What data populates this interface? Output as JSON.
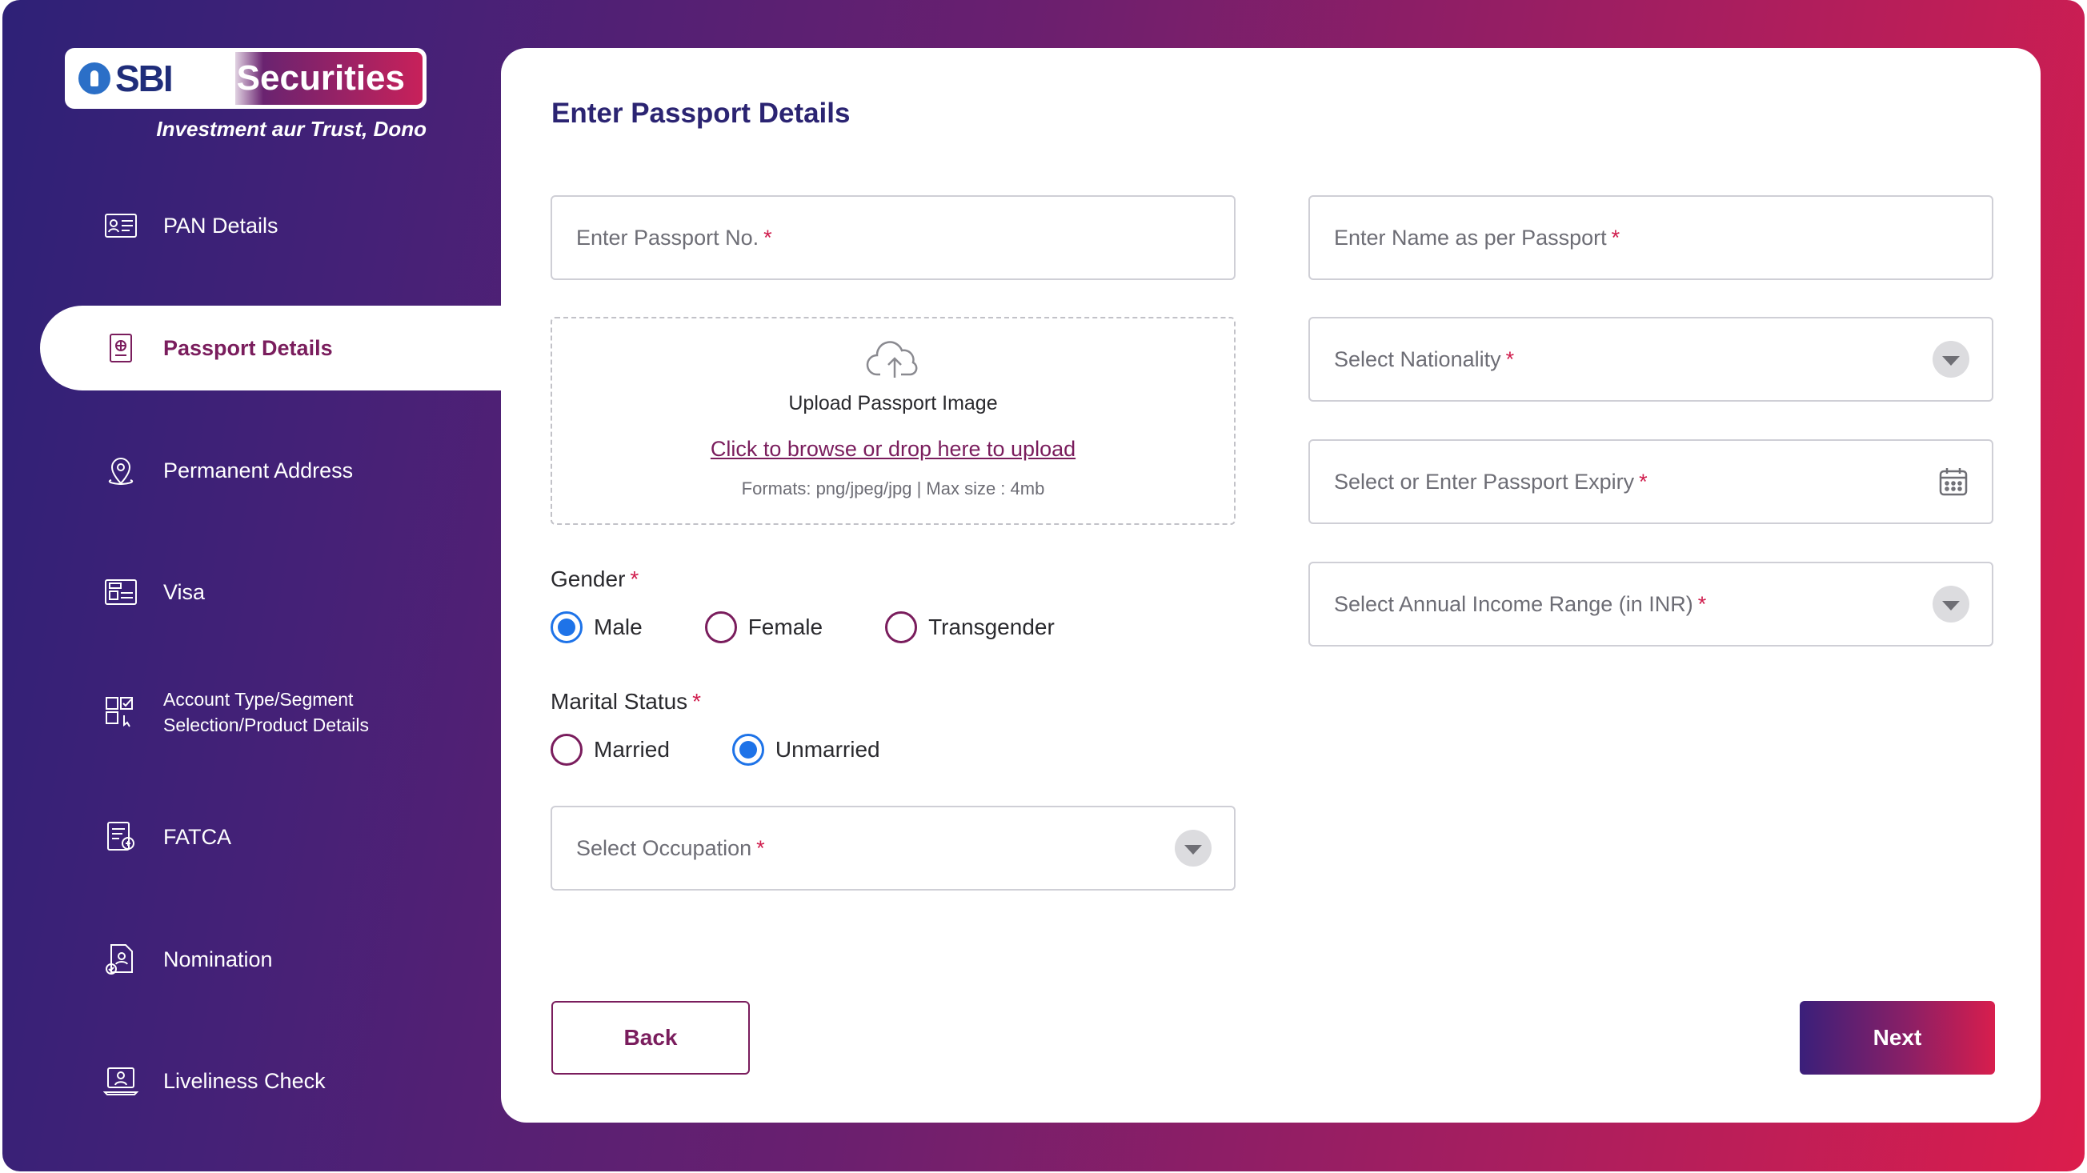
{
  "brand": {
    "logo_sbi": "SBI",
    "logo_securities": "Securities",
    "tagline": "Investment aur Trust, Dono"
  },
  "sidebar": {
    "items": [
      {
        "label": "PAN Details",
        "icon": "id-card-icon",
        "active": false
      },
      {
        "label": "Passport Details",
        "icon": "passport-icon",
        "active": true
      },
      {
        "label": "Permanent Address",
        "icon": "location-pin-icon",
        "active": false
      },
      {
        "label": "Visa",
        "icon": "visa-card-icon",
        "active": false
      },
      {
        "label_line1": "Account Type/Segment",
        "label_line2": "Selection/Product Details",
        "icon": "checklist-icon",
        "active": false
      },
      {
        "label": "FATCA",
        "icon": "tax-document-icon",
        "active": false
      },
      {
        "label": "Nomination",
        "icon": "nomination-document-icon",
        "active": false
      },
      {
        "label": "Liveliness Check",
        "icon": "laptop-user-icon",
        "active": false
      }
    ]
  },
  "form": {
    "title": "Enter Passport Details",
    "passport_no": {
      "placeholder": "Enter Passport No.",
      "required": "*"
    },
    "name_as_passport": {
      "placeholder": "Enter Name as per Passport",
      "required": "*"
    },
    "nationality": {
      "placeholder": "Select Nationality",
      "required": "*"
    },
    "passport_expiry": {
      "placeholder": "Select or Enter Passport Expiry",
      "required": "*"
    },
    "annual_income": {
      "placeholder": "Select Annual Income Range (in INR)",
      "required": "*"
    },
    "occupation": {
      "placeholder": "Select Occupation",
      "required": "*"
    },
    "upload": {
      "title": "Upload Passport Image",
      "link": "Click to browse or drop here to upload",
      "note": "Formats: png/jpeg/jpg | Max size : 4mb"
    },
    "gender": {
      "label": "Gender",
      "required": "*",
      "options": [
        "Male",
        "Female",
        "Transgender"
      ],
      "selected": "Male"
    },
    "marital_status": {
      "label": "Marital Status",
      "required": "*",
      "options": [
        "Married",
        "Unmarried"
      ],
      "selected": "Unmarried"
    }
  },
  "actions": {
    "back": "Back",
    "next": "Next"
  },
  "colors": {
    "accent": "#7a1d5d",
    "title": "#2b2472",
    "radio_selected": "#1e73e8",
    "required": "#d01e4e"
  }
}
